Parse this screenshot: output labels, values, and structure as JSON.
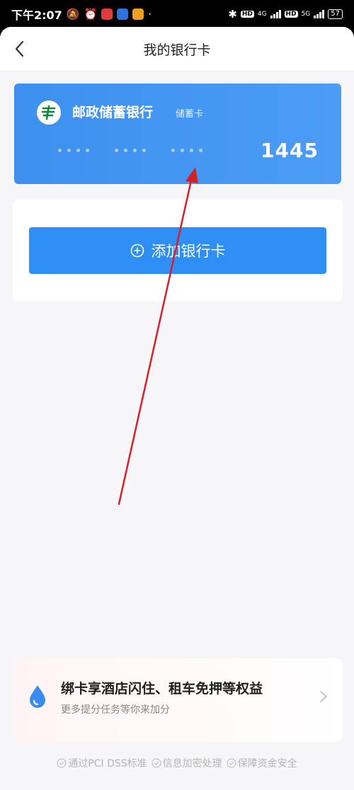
{
  "status_bar": {
    "time": "下午2:07",
    "network_4g": "4G",
    "network_5g": "5G",
    "hd_label": "HD",
    "battery": "57"
  },
  "nav": {
    "title": "我的银行卡"
  },
  "bank_card": {
    "bank_name": "邮政储蓄银行",
    "card_type": "储蓄卡",
    "last4": "1445",
    "brand_color": "#3d90ee"
  },
  "add_card": {
    "label": "添加银行卡",
    "icon": "plus-circle-icon"
  },
  "promo": {
    "title": "绑卡享酒店闪住、租车免押等权益",
    "subtitle": "更多提分任务等你来加分"
  },
  "security": {
    "items": [
      "通过PCI DSS标准",
      "信息加密处理",
      "保障资金安全"
    ]
  },
  "colors": {
    "accent": "#2f8ef4",
    "annotation_arrow": "#d62027"
  }
}
